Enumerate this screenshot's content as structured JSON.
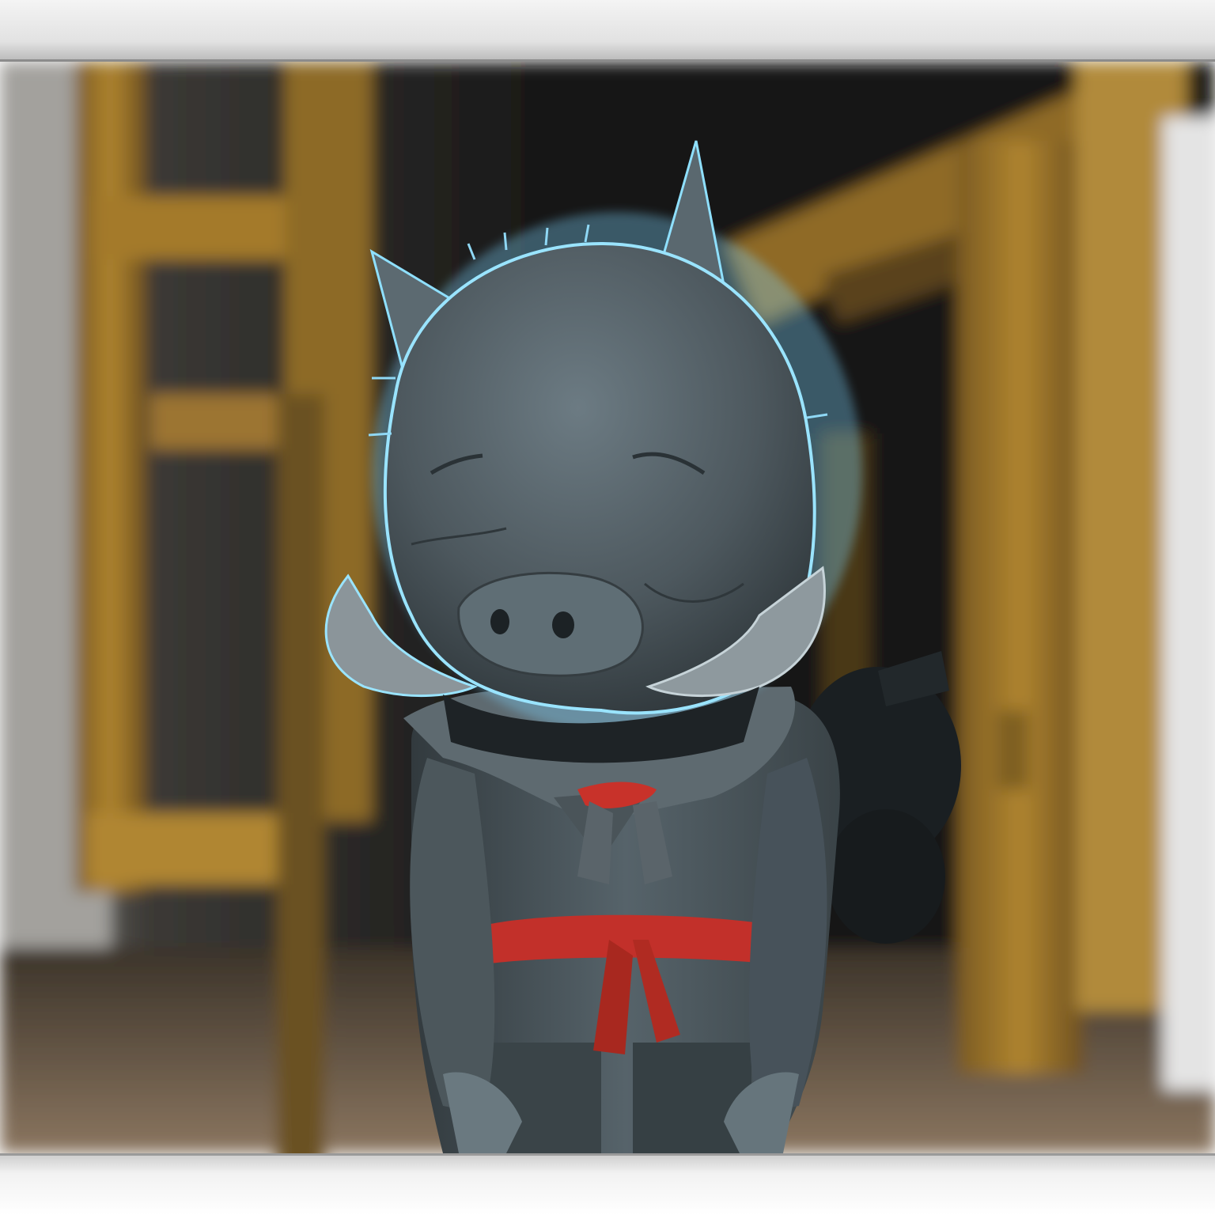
{
  "image": {
    "subject": "boar-character",
    "colors": {
      "backdrop": "#151515",
      "wood": "#a7792c",
      "wall": "#8f8e8c",
      "floor": "#6e5c48",
      "fur": "#4a5257",
      "fur_light": "#66757c",
      "rim_glow": "#7fd6ff",
      "tusk": "#8b959a",
      "cloth": "#5a6469",
      "sash": "#c8322a",
      "frame": "#e6e6e6"
    }
  }
}
